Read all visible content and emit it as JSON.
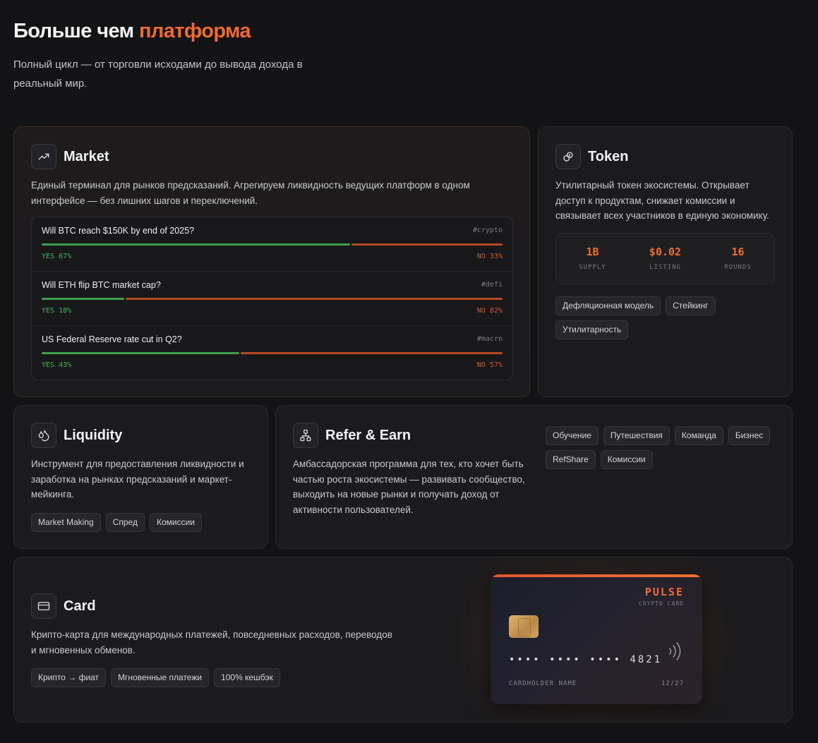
{
  "header": {
    "title_main": "Больше чем",
    "title_accent": "платформа",
    "subtitle": "Полный цикл — от торговли исходами до вывода дохода в реальный мир."
  },
  "colors": {
    "accent": "#f06a32",
    "yes": "#3fa04c",
    "no": "#b54a22",
    "background": "#131315",
    "card": "#1b1b1e"
  },
  "market": {
    "icon": "trending-up-icon",
    "title": "Market",
    "description": "Единый терминал для рынков предсказаний. Агрегируем ликвидность ведущих платформ в одном интерфейсе — без лишних шагов и переключений.",
    "items": [
      {
        "question": "Will BTC reach $150K by end of 2025?",
        "tag": "#crypto",
        "yes_pct": 67,
        "yes_label": "YES 67%",
        "no_label": "NO 33%"
      },
      {
        "question": "Will ETH flip BTC market cap?",
        "tag": "#defi",
        "yes_pct": 18,
        "yes_label": "YES 18%",
        "no_label": "NO 82%"
      },
      {
        "question": "US Federal Reserve rate cut in Q2?",
        "tag": "#macro",
        "yes_pct": 43,
        "yes_label": "YES 43%",
        "no_label": "NO 57%"
      }
    ]
  },
  "token": {
    "icon": "coins-icon",
    "title": "Token",
    "description": "Утилитарный токен экосистемы. Открывает доступ к продуктам, снижает комиссии и связывает всех участников в единую экономику.",
    "stats": [
      {
        "value": "1B",
        "label": "SUPPLY"
      },
      {
        "value": "$0.02",
        "label": "LISTING"
      },
      {
        "value": "16",
        "label": "ROUNDS"
      }
    ],
    "tags": [
      "Дефляционная модель",
      "Стейкинг",
      "Утилитарность"
    ]
  },
  "liquidity": {
    "icon": "droplets-icon",
    "title": "Liquidity",
    "description": "Инструмент для предоставления ликвидности и заработка на рынках предсказаний и маркет-мейкинга.",
    "tags": [
      "Market Making",
      "Спред",
      "Комиссии"
    ]
  },
  "refer": {
    "icon": "network-icon",
    "title": "Refer & Earn",
    "description": "Амбассадорская программа для тех, кто хочет быть частью роста экосистемы — развивать сообщество, выходить на новые рынки и получать доход от активности пользователей.",
    "tags": [
      "Обучение",
      "Путешествия",
      "Команда",
      "Бизнес",
      "RefShare",
      "Комиссии"
    ]
  },
  "card": {
    "icon": "credit-card-icon",
    "title": "Card",
    "description": "Крипто-карта для международных платежей, повседневных расходов, переводов и мгновенных обменов.",
    "tags": [
      "Крипто → фиат",
      "Мгновенные платежи",
      "100% кешбэк"
    ],
    "visual": {
      "brand": "PULSE",
      "brand_sub": "CRYPTO CARD",
      "number": "•••• •••• •••• 4821",
      "holder": "CARDHOLDER NAME",
      "expiry": "12/27"
    }
  }
}
